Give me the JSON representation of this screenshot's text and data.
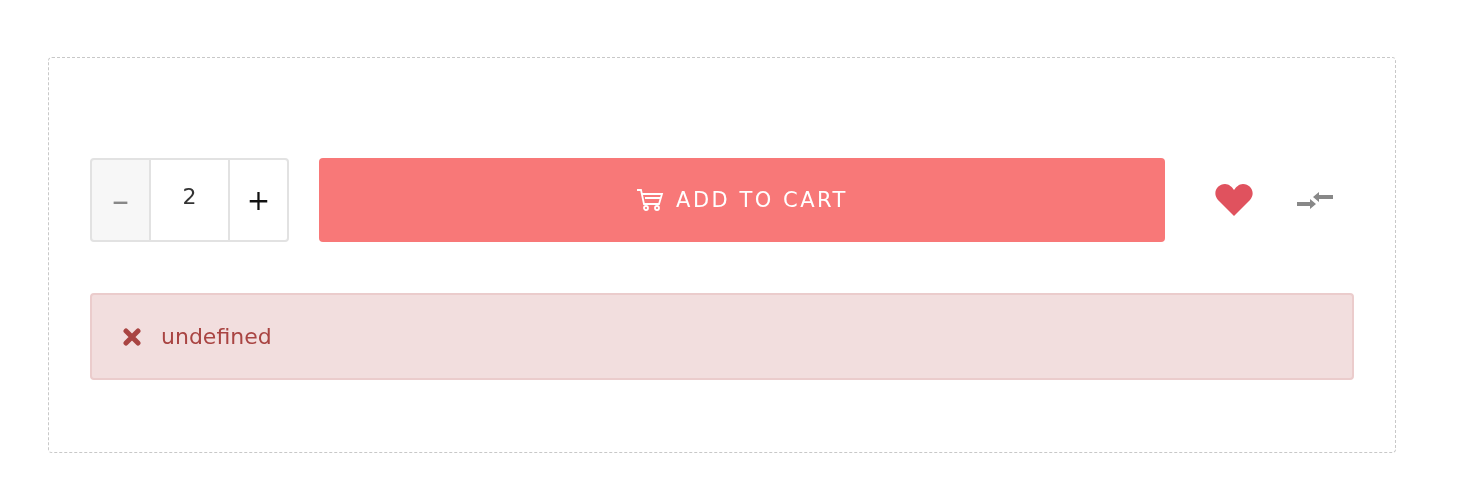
{
  "quantity": {
    "decrement": "–",
    "value": "2",
    "increment": "+"
  },
  "add_to_cart": {
    "label": "ADD TO CART"
  },
  "alert": {
    "message": "undefined"
  }
}
